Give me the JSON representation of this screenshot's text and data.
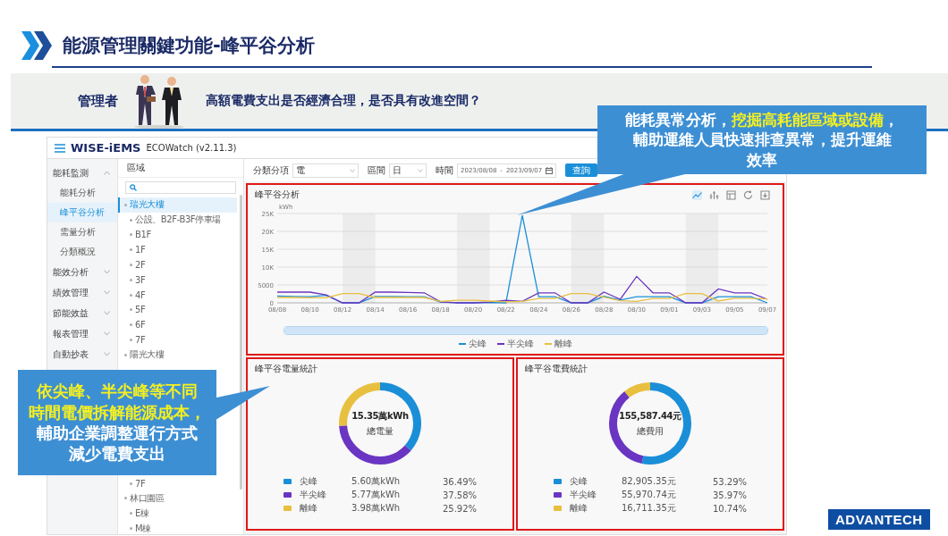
{
  "slide": {
    "title": "能源管理關鍵功能-峰平谷分析",
    "role": "管理者",
    "question": "高額電費支出是否經濟合理，是否具有改進空間？",
    "logo": "ADVANTECH"
  },
  "app": {
    "brand": "WISE-iEMS",
    "product": "ECOWatch (v2.11.3)"
  },
  "sidebar": {
    "items": [
      {
        "label": "能耗監測",
        "expanded": true,
        "children": [
          {
            "label": "能耗分析",
            "selected": false
          },
          {
            "label": "峰平谷分析",
            "selected": true
          },
          {
            "label": "需量分析",
            "selected": false
          },
          {
            "label": "分類概況",
            "selected": false
          }
        ]
      },
      {
        "label": "能效分析",
        "expanded": false
      },
      {
        "label": "績效管理",
        "expanded": false
      },
      {
        "label": "節能效益",
        "expanded": false
      },
      {
        "label": "報表管理",
        "expanded": false
      },
      {
        "label": "自動抄表",
        "expanded": false
      }
    ]
  },
  "tree": {
    "heading": "區域",
    "items": [
      {
        "label": "瑞光大樓",
        "selected": true,
        "children": [
          {
            "label": "公設、B2F-B3F停車場",
            "selected": false
          },
          {
            "label": "B1F",
            "selected": false
          },
          {
            "label": "1F",
            "selected": false
          },
          {
            "label": "2F",
            "selected": false
          },
          {
            "label": "3F",
            "selected": false
          },
          {
            "label": "4F",
            "selected": false
          },
          {
            "label": "5F",
            "selected": false
          },
          {
            "label": "6F",
            "selected": false
          },
          {
            "label": "7F",
            "selected": false
          }
        ]
      },
      {
        "label": "陽光大樓",
        "selected": false,
        "children": [
          {
            "label": "7F",
            "selected": false
          }
        ]
      },
      {
        "label": "林口園區",
        "selected": false,
        "children": [
          {
            "label": "E棟",
            "selected": false
          },
          {
            "label": "M棟",
            "selected": false
          }
        ]
      }
    ]
  },
  "filters": [
    {
      "kind": "select",
      "label": "分類分項",
      "value": "電"
    },
    {
      "kind": "select",
      "label": "區間",
      "value": "日"
    },
    {
      "kind": "daterange",
      "label": "時間",
      "from": "2023/08/08",
      "separator": "-",
      "to": "2023/09/07"
    }
  ],
  "query_button": "查詢",
  "trend": {
    "title": "峰平谷分析",
    "toolbar": [
      {
        "kind": "line",
        "selected": true
      },
      {
        "kind": "bar",
        "selected": false
      },
      {
        "kind": "table",
        "selected": false
      },
      {
        "kind": "refresh",
        "selected": false
      },
      {
        "kind": "download",
        "selected": false
      }
    ],
    "range_slider": {
      "level": 1
    },
    "chart_data": {
      "type": "line",
      "ylabel": "kWh",
      "grid": true,
      "categories": [
        "08/08",
        null,
        "08/10",
        null,
        "08/12",
        null,
        "08/14",
        null,
        "08/16",
        null,
        "08/18",
        null,
        "08/20",
        null,
        "08/22",
        null,
        "08/24",
        null,
        "08/26",
        null,
        "08/28",
        null,
        "08/30",
        null,
        "09/01",
        null,
        "09/03",
        null,
        "09/05",
        null,
        "09/07"
      ],
      "ylim": [
        0,
        25000
      ],
      "yticks": [
        {
          "value": 0,
          "label": "0"
        },
        {
          "value": 5000,
          "label": "5000"
        },
        {
          "value": 10000,
          "label": "10K"
        },
        {
          "value": 15000,
          "label": "15K"
        },
        {
          "value": 20000,
          "label": "20K"
        },
        {
          "value": 25000,
          "label": "25K"
        }
      ],
      "series": [
        {
          "name": "尖峰",
          "color": "#1a8fd8",
          "values": [
            1900,
            1800,
            1700,
            2100,
            0,
            0,
            1800,
            1800,
            1700,
            1700,
            200,
            0,
            0,
            100,
            0,
            24500,
            1700,
            1700,
            0,
            0,
            1800,
            800,
            1700,
            1700,
            1700,
            0,
            0,
            1700,
            1700,
            1700,
            0
          ]
        },
        {
          "name": "半尖峰",
          "color": "#6a35c2",
          "values": [
            3000,
            3000,
            3000,
            2200,
            0,
            0,
            3000,
            3000,
            2900,
            2800,
            300,
            0,
            0,
            200,
            700,
            400,
            2800,
            2800,
            0,
            0,
            3000,
            1000,
            7400,
            2800,
            2800,
            0,
            0,
            3900,
            2800,
            2800,
            1000
          ]
        },
        {
          "name": "離峰",
          "color": "#e8c040",
          "values": [
            1500,
            1500,
            1400,
            1400,
            2600,
            2600,
            1500,
            1500,
            1500,
            1500,
            400,
            700,
            700,
            500,
            300,
            400,
            1200,
            1200,
            2600,
            2600,
            1600,
            600,
            400,
            1200,
            1200,
            2600,
            2600,
            500,
            1300,
            1300,
            1100
          ]
        }
      ]
    }
  },
  "stats": [
    {
      "title": "峰平谷電量統計",
      "total": "15.35萬kWh",
      "total_label": "總電量",
      "chart_data": {
        "type": "donut",
        "categories": [
          "尖峰",
          "半尖峰",
          "離峰"
        ],
        "values": [
          36.49,
          37.58,
          25.92
        ]
      },
      "legend": [
        {
          "color": "#1a8fd8",
          "amount": "5.60萬kWh",
          "share": "36.49%"
        },
        {
          "color": "#6a35c2",
          "amount": "5.77萬kWh",
          "share": "37.58%"
        },
        {
          "color": "#e8c040",
          "amount": "3.98萬kWh",
          "share": "25.92%"
        }
      ]
    },
    {
      "title": "峰平谷電費統計",
      "total": "155,587.44元",
      "total_label": "總費用",
      "chart_data": {
        "type": "donut",
        "categories": [
          "尖峰",
          "半尖峰",
          "離峰"
        ],
        "values": [
          53.29,
          35.97,
          10.74
        ]
      },
      "legend": [
        {
          "color": "#1a8fd8",
          "amount": "82,905.35元",
          "share": "53.29%"
        },
        {
          "color": "#6a35c2",
          "amount": "55,970.74元",
          "share": "35.97%"
        },
        {
          "color": "#e8c040",
          "amount": "16,711.35元",
          "share": "10.74%"
        }
      ]
    }
  ],
  "callouts": [
    {
      "lines": [
        [
          {
            "text": "能耗異常分析，",
            "highlight": false
          },
          {
            "text": "挖掘高耗能區域或設備",
            "highlight": true
          },
          {
            "text": "，",
            "highlight": false
          }
        ],
        [
          {
            "text": "輔助運維人員快速排查異常，提升運維",
            "highlight": false
          }
        ],
        [
          {
            "text": "效率",
            "highlight": false
          }
        ]
      ]
    },
    {
      "lines": [
        [
          {
            "text": "依尖峰、半尖峰等不同",
            "highlight": true
          }
        ],
        [
          {
            "text": "時間電價拆解能源成本，",
            "highlight": true
          }
        ],
        [
          {
            "text": "輔助企業調整運行方式",
            "highlight": false
          }
        ],
        [
          {
            "text": "減少電費支出",
            "highlight": false
          }
        ]
      ]
    }
  ]
}
